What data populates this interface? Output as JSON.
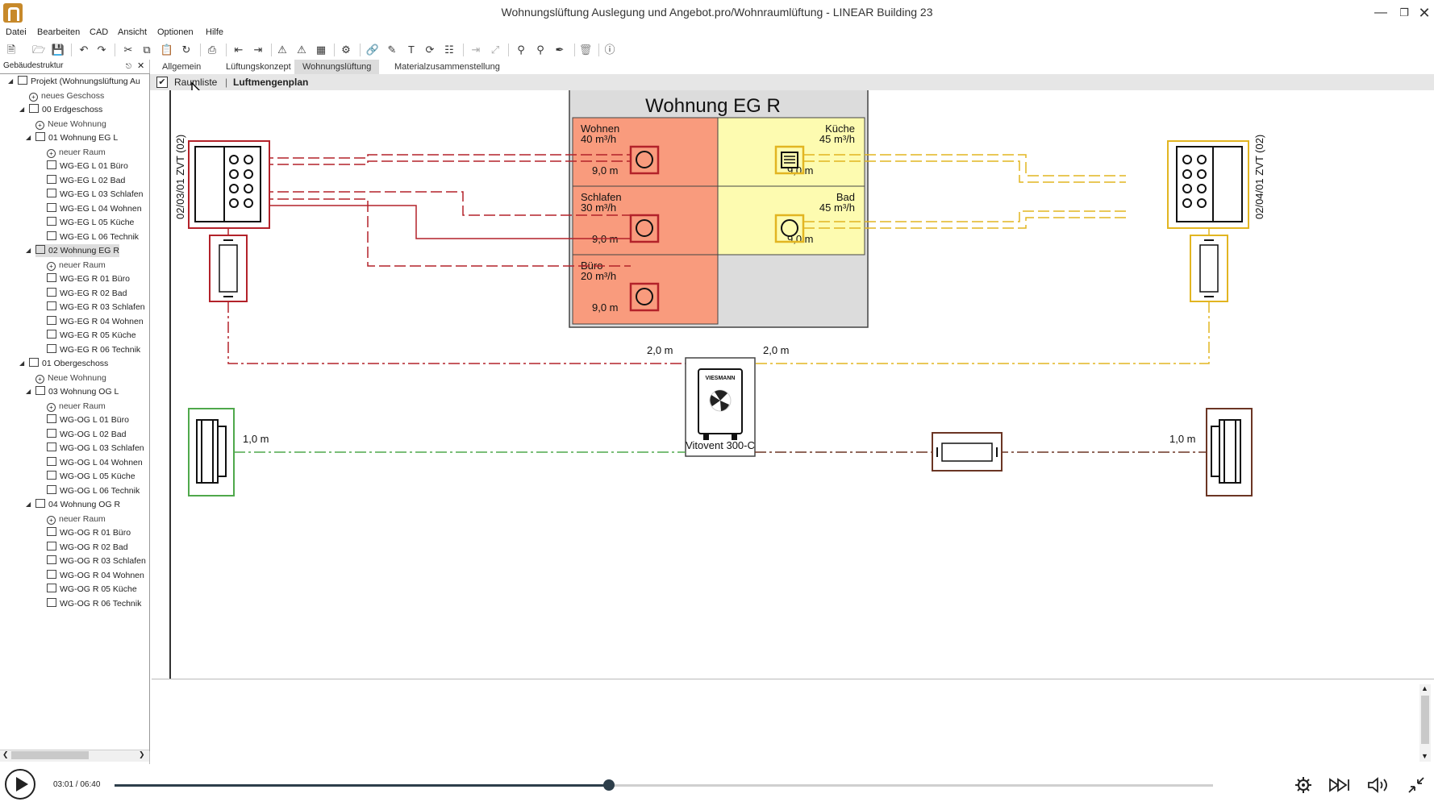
{
  "window": {
    "title": "Wohnungslüftung Auslegung und Angebot.pro/Wohnraumlüftung - LINEAR Building 23"
  },
  "menu": [
    "Datei",
    "Bearbeiten",
    "CAD",
    "Ansicht",
    "Optionen",
    "Hilfe"
  ],
  "left_panel": {
    "header": "Gebäudestruktur",
    "tree": [
      {
        "label": "Projekt (Wohnungslüftung Au",
        "type": "project",
        "level": 0,
        "expanded": true
      },
      {
        "label": "neues Geschoss",
        "type": "add",
        "level": 1
      },
      {
        "label": "00 Erdgeschoss",
        "type": "floor",
        "level": 1,
        "expanded": true
      },
      {
        "label": "Neue Wohnung",
        "type": "add",
        "level": 2
      },
      {
        "label": "01 Wohnung EG L",
        "type": "flat",
        "level": 2,
        "expanded": true
      },
      {
        "label": "neuer Raum",
        "type": "add",
        "level": 3
      },
      {
        "label": "WG-EG L 01 Büro",
        "type": "room",
        "level": 3
      },
      {
        "label": "WG-EG L 02 Bad",
        "type": "room",
        "level": 3
      },
      {
        "label": "WG-EG L 03 Schlafen",
        "type": "room",
        "level": 3
      },
      {
        "label": "WG-EG L 04 Wohnen",
        "type": "room",
        "level": 3
      },
      {
        "label": "WG-EG L 05 Küche",
        "type": "room",
        "level": 3
      },
      {
        "label": "WG-EG L 06 Technik",
        "type": "room",
        "level": 3
      },
      {
        "label": "02 Wohnung EG R",
        "type": "flat",
        "level": 2,
        "expanded": true,
        "selected": true
      },
      {
        "label": "neuer Raum",
        "type": "add",
        "level": 3
      },
      {
        "label": "WG-EG R 01 Büro",
        "type": "room",
        "level": 3
      },
      {
        "label": "WG-EG R 02 Bad",
        "type": "room",
        "level": 3
      },
      {
        "label": "WG-EG R 03 Schlafen",
        "type": "room",
        "level": 3
      },
      {
        "label": "WG-EG R 04 Wohnen",
        "type": "room",
        "level": 3
      },
      {
        "label": "WG-EG R 05 Küche",
        "type": "room",
        "level": 3
      },
      {
        "label": "WG-EG R 06 Technik",
        "type": "room",
        "level": 3
      },
      {
        "label": "01 Obergeschoss",
        "type": "floor",
        "level": 1,
        "expanded": true
      },
      {
        "label": "Neue Wohnung",
        "type": "add",
        "level": 2
      },
      {
        "label": "03 Wohnung OG L",
        "type": "flat",
        "level": 2,
        "expanded": true
      },
      {
        "label": "neuer Raum",
        "type": "add",
        "level": 3
      },
      {
        "label": "WG-OG L 01 Büro",
        "type": "room",
        "level": 3
      },
      {
        "label": "WG-OG L 02 Bad",
        "type": "room",
        "level": 3
      },
      {
        "label": "WG-OG L 03 Schlafen",
        "type": "room",
        "level": 3
      },
      {
        "label": "WG-OG L 04 Wohnen",
        "type": "room",
        "level": 3
      },
      {
        "label": "WG-OG L 05 Küche",
        "type": "room",
        "level": 3
      },
      {
        "label": "WG-OG L 06 Technik",
        "type": "room",
        "level": 3
      },
      {
        "label": "04 Wohnung OG R",
        "type": "flat",
        "level": 2,
        "expanded": true
      },
      {
        "label": "neuer Raum",
        "type": "add",
        "level": 3
      },
      {
        "label": "WG-OG R 01 Büro",
        "type": "room",
        "level": 3
      },
      {
        "label": "WG-OG R 02 Bad",
        "type": "room",
        "level": 3
      },
      {
        "label": "WG-OG R 03 Schlafen",
        "type": "room",
        "level": 3
      },
      {
        "label": "WG-OG R 04 Wohnen",
        "type": "room",
        "level": 3
      },
      {
        "label": "WG-OG R 05 Küche",
        "type": "room",
        "level": 3
      },
      {
        "label": "WG-OG R 06 Technik",
        "type": "room",
        "level": 3
      }
    ]
  },
  "tabs": [
    {
      "label": "Allgemein",
      "active": false
    },
    {
      "label": "Lüftungskonzept",
      "active": false
    },
    {
      "label": "Wohnungslüftung",
      "active": true
    },
    {
      "label": "Materialzusammenstellung",
      "active": false
    }
  ],
  "subbar": {
    "checkbox_checked": true,
    "raumliste": "Raumliste",
    "sep": "|",
    "luftmengenplan": "Luftmengenplan"
  },
  "plan": {
    "apartment_title": "Wohnung EG R",
    "rooms": {
      "wohnen": {
        "name": "Wohnen",
        "flow": "40 m³/h",
        "length": "9,0 m"
      },
      "kueche": {
        "name": "Küche",
        "flow": "45 m³/h",
        "length": "9,0 m"
      },
      "schlafen": {
        "name": "Schlafen",
        "flow": "30 m³/h",
        "length": "9,0 m"
      },
      "bad": {
        "name": "Bad",
        "flow": "45 m³/h",
        "length": "9,0 m"
      },
      "buero": {
        "name": "Büro",
        "flow": "20 m³/h",
        "length": "9,0 m"
      }
    },
    "left_distributor": "02/03/01 ZVT (02)",
    "right_distributor": "02/04/01 ZVT (02)",
    "left_trunk_length": "2,0 m",
    "right_trunk_length": "2,0 m",
    "unit_name": "Vitovent 300-C",
    "unit_brand": "VIESMANN",
    "left_outdoor_length": "1,0 m",
    "right_outdoor_length": "1,0 m",
    "colors": {
      "supply": "#b3222a",
      "extract": "#e2b521",
      "outdoor": "#4fa84b",
      "exhaust": "#6b3524",
      "supply_fill": "#f99b7d",
      "extract_fill": "#fdfbb0"
    }
  },
  "player": {
    "time": "03:01 / 06:40",
    "progress": 0.45
  }
}
